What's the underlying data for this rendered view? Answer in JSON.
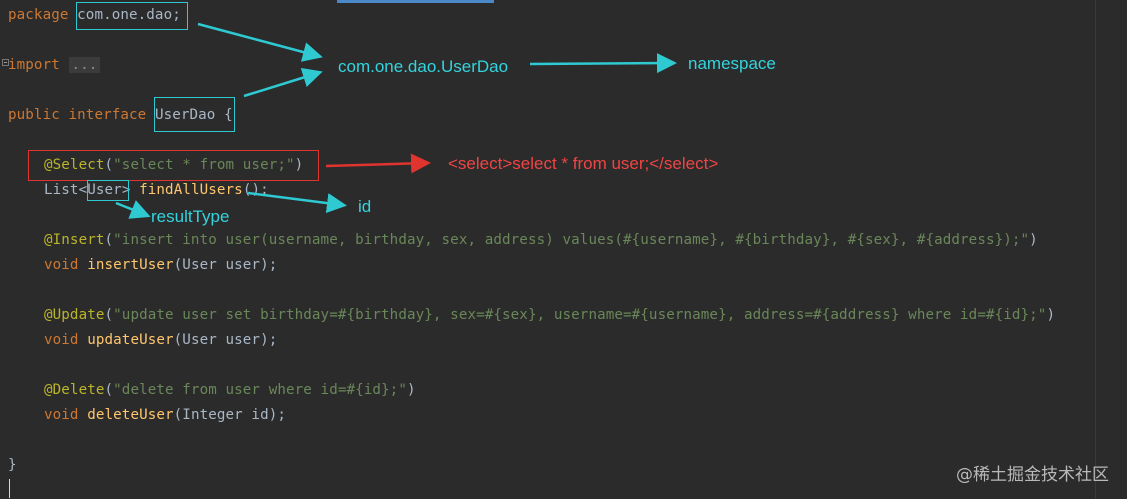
{
  "code": {
    "line1": {
      "kw": "package",
      "pkg": "com.one.dao;"
    },
    "line2": {
      "kw": "import",
      "folded": "..."
    },
    "line3": {
      "kw_public": "public",
      "kw_interface": "interface",
      "name": "UserDao",
      "brace": "{"
    },
    "line4": {
      "ann": "@Select",
      "open": "(",
      "str": "\"select * from user;\"",
      "close": ")"
    },
    "line5": {
      "type": "List",
      "lt": "<",
      "generic": "User",
      "gt": ">",
      "method": "findAllUsers",
      "rest": "();"
    },
    "line6": {
      "ann": "@Insert",
      "open": "(",
      "str": "\"insert into user(username, birthday, sex, address) values(#{username}, #{birthday}, #{sex}, #{address});\"",
      "close": ")"
    },
    "line7": {
      "kw": "void",
      "method": "insertUser",
      "rest": "(User user);"
    },
    "line8": {
      "ann": "@Update",
      "open": "(",
      "str": "\"update user set birthday=#{birthday}, sex=#{sex}, username=#{username}, address=#{address} where id=#{id};\"",
      "close": ")"
    },
    "line9": {
      "kw": "void",
      "method": "updateUser",
      "rest": "(User user);"
    },
    "line10": {
      "ann": "@Delete",
      "open": "(",
      "str": "\"delete from user where id=#{id};\"",
      "close": ")"
    },
    "line11": {
      "kw": "void",
      "method": "deleteUser",
      "rest": "(Integer id);"
    },
    "line12": {
      "brace": "}"
    }
  },
  "annotations": {
    "namespace_source": "com.one.dao.UserDao",
    "namespace_label": "namespace",
    "select_xml": "<select>select * from user;</select>",
    "id_label": "id",
    "result_type_label": "resultType"
  },
  "colors": {
    "background": "#2b2b2b",
    "keyword": "#cc7832",
    "annotation": "#bbb529",
    "string": "#6a8759",
    "method": "#ffc66d",
    "plain": "#a9b7c6",
    "highlight_cyan": "#2fc9d2",
    "highlight_red": "#e0342f"
  },
  "watermark": "@稀土掘金技术社区"
}
